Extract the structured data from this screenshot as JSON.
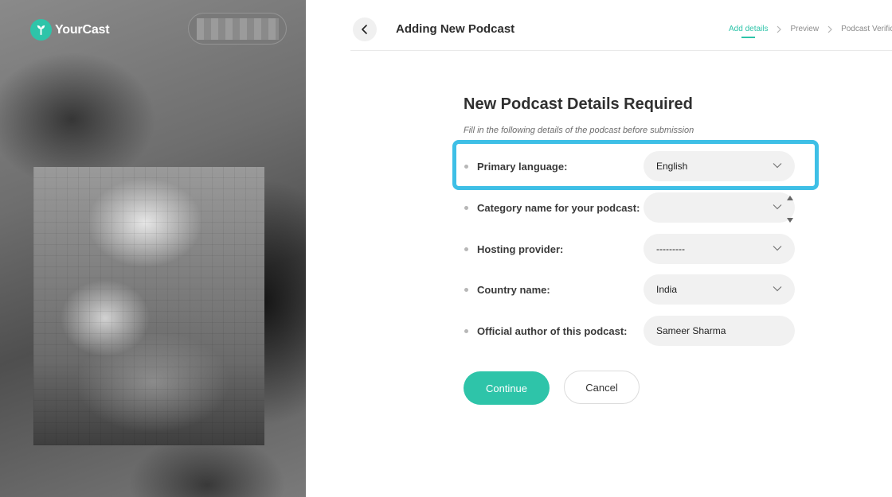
{
  "brand": {
    "name": "YourCast",
    "accent": "#2ec4a9"
  },
  "header": {
    "title": "Adding New Podcast",
    "back_icon": "chevron-left-icon",
    "steps": [
      {
        "label": "Add details",
        "active": true
      },
      {
        "label": "Preview",
        "active": false
      },
      {
        "label": "Podcast Verific",
        "active": false
      }
    ]
  },
  "form": {
    "title": "New Podcast Details Required",
    "subtitle": "Fill in the following details of the podcast before submission",
    "fields": [
      {
        "label": "Primary language:",
        "value": "English",
        "type": "select",
        "highlighted": true
      },
      {
        "label": "Category name for your podcast:",
        "value": "",
        "type": "select"
      },
      {
        "label": "Hosting provider:",
        "value": "---------",
        "type": "select"
      },
      {
        "label": "Country name:",
        "value": "India",
        "type": "select"
      },
      {
        "label": "Official author of this podcast:",
        "value": "Sameer Sharma",
        "type": "text"
      }
    ],
    "highlight_color": "#3ebfe6"
  },
  "actions": {
    "continue_label": "Continue",
    "cancel_label": "Cancel"
  }
}
